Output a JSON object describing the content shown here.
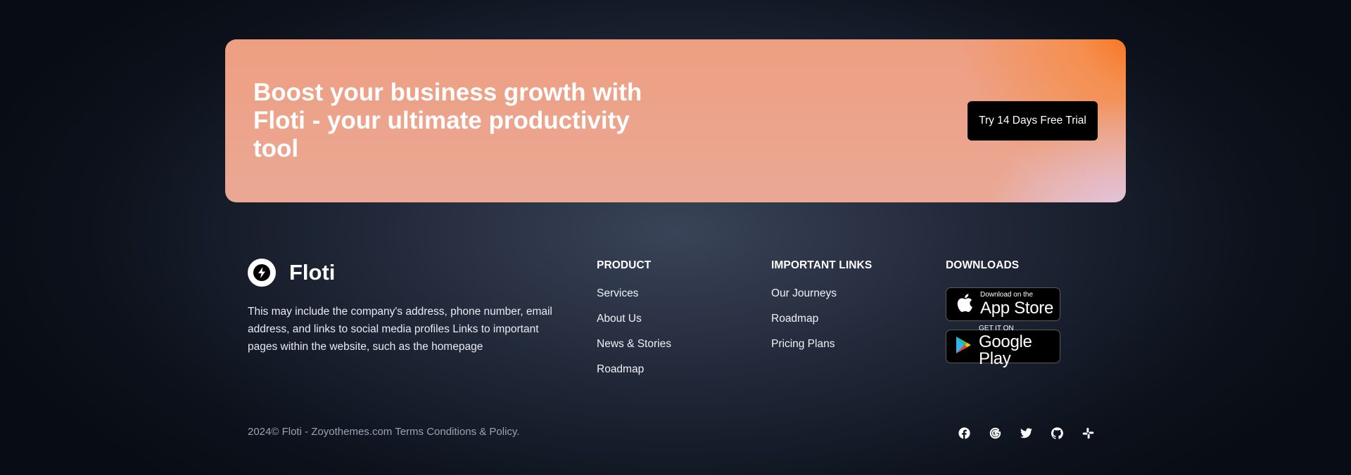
{
  "cta": {
    "title": "Boost your business growth with Floti - your ultimate productivity tool",
    "button_label": "Try 14 Days Free Trial"
  },
  "brand": {
    "name": "Floti",
    "logo_icon": "lightning-bolt-icon",
    "description": "This may include the company's address, phone number, email address, and links to social media profiles Links to important pages within the website, such as the homepage"
  },
  "columns": {
    "product": {
      "title": "PRODUCT",
      "items": [
        "Services",
        "About Us",
        "News & Stories",
        "Roadmap"
      ]
    },
    "links": {
      "title": "IMPORTANT LINKS",
      "items": [
        "Our Journeys",
        "Roadmap",
        "Pricing Plans"
      ]
    },
    "downloads": {
      "title": "DOWNLOADS",
      "app_store": {
        "small": "Download on the",
        "big": "App Store",
        "icon": "apple-icon"
      },
      "google_play": {
        "small": "GET IT ON",
        "big": "Google Play",
        "icon": "google-play-icon"
      }
    }
  },
  "footer": {
    "copyright": "2024© Floti - Zoyothemes.com Terms Conditions & Policy.",
    "socials": [
      "facebook-icon",
      "google-icon",
      "twitter-icon",
      "github-icon",
      "slack-icon"
    ]
  },
  "colors": {
    "cta_peach": "#ee9f82",
    "cta_orange": "#f86e14",
    "cta_lavender": "#dcd7fa",
    "background_dark": "#0c111b"
  }
}
